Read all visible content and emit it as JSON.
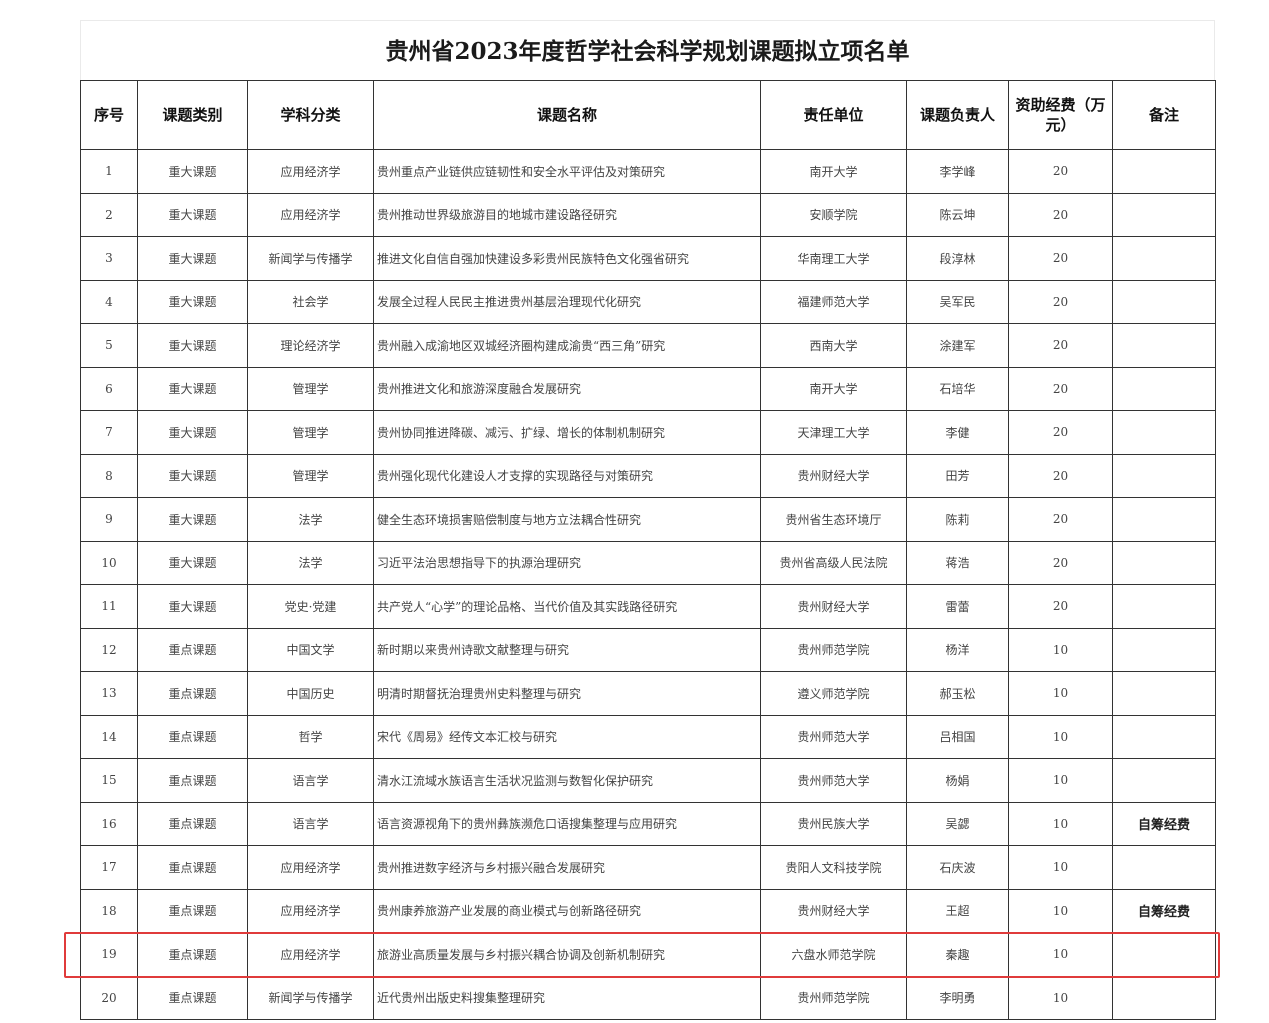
{
  "title": "贵州省2023年度哲学社会科学规划课题拟立项名单",
  "columns": [
    "序号",
    "课题类别",
    "学科分类",
    "课题名称",
    "责任单位",
    "课题负责人",
    "资助经费（万元）",
    "备注"
  ],
  "rows": [
    [
      "1",
      "重大课题",
      "应用经济学",
      "贵州重点产业链供应链韧性和安全水平评估及对策研究",
      "南开大学",
      "李学峰",
      "20",
      ""
    ],
    [
      "2",
      "重大课题",
      "应用经济学",
      "贵州推动世界级旅游目的地城市建设路径研究",
      "安顺学院",
      "陈云坤",
      "20",
      ""
    ],
    [
      "3",
      "重大课题",
      "新闻学与传播学",
      "推进文化自信自强加快建设多彩贵州民族特色文化强省研究",
      "华南理工大学",
      "段淳林",
      "20",
      ""
    ],
    [
      "4",
      "重大课题",
      "社会学",
      "发展全过程人民民主推进贵州基层治理现代化研究",
      "福建师范大学",
      "吴军民",
      "20",
      ""
    ],
    [
      "5",
      "重大课题",
      "理论经济学",
      "贵州融入成渝地区双城经济圈构建成渝贵“西三角”研究",
      "西南大学",
      "涂建军",
      "20",
      ""
    ],
    [
      "6",
      "重大课题",
      "管理学",
      "贵州推进文化和旅游深度融合发展研究",
      "南开大学",
      "石培华",
      "20",
      ""
    ],
    [
      "7",
      "重大课题",
      "管理学",
      "贵州协同推进降碳、减污、扩绿、增长的体制机制研究",
      "天津理工大学",
      "李健",
      "20",
      ""
    ],
    [
      "8",
      "重大课题",
      "管理学",
      "贵州强化现代化建设人才支撑的实现路径与对策研究",
      "贵州财经大学",
      "田芳",
      "20",
      ""
    ],
    [
      "9",
      "重大课题",
      "法学",
      "健全生态环境损害赔偿制度与地方立法耦合性研究",
      "贵州省生态环境厅",
      "陈莉",
      "20",
      ""
    ],
    [
      "10",
      "重大课题",
      "法学",
      "习近平法治思想指导下的执源治理研究",
      "贵州省高级人民法院",
      "蒋浩",
      "20",
      ""
    ],
    [
      "11",
      "重大课题",
      "党史·党建",
      "共产党人“心学”的理论品格、当代价值及其实践路径研究",
      "贵州财经大学",
      "雷蕾",
      "20",
      ""
    ],
    [
      "12",
      "重点课题",
      "中国文学",
      "新时期以来贵州诗歌文献整理与研究",
      "贵州师范学院",
      "杨洋",
      "10",
      ""
    ],
    [
      "13",
      "重点课题",
      "中国历史",
      "明清时期督抚治理贵州史料整理与研究",
      "遵义师范学院",
      "郝玉松",
      "10",
      ""
    ],
    [
      "14",
      "重点课题",
      "哲学",
      "宋代《周易》经传文本汇校与研究",
      "贵州师范大学",
      "吕相国",
      "10",
      ""
    ],
    [
      "15",
      "重点课题",
      "语言学",
      "清水江流域水族语言生活状况监测与数智化保护研究",
      "贵州师范大学",
      "杨娟",
      "10",
      ""
    ],
    [
      "16",
      "重点课题",
      "语言学",
      "语言资源视角下的贵州彝族濒危口语搜集整理与应用研究",
      "贵州民族大学",
      "吴勰",
      "10",
      "自筹经费"
    ],
    [
      "17",
      "重点课题",
      "应用经济学",
      "贵州推进数字经济与乡村振兴融合发展研究",
      "贵阳人文科技学院",
      "石庆波",
      "10",
      ""
    ],
    [
      "18",
      "重点课题",
      "应用经济学",
      "贵州康养旅游产业发展的商业模式与创新路径研究",
      "贵州财经大学",
      "王超",
      "10",
      "自筹经费"
    ],
    [
      "19",
      "重点课题",
      "应用经济学",
      "旅游业高质量发展与乡村振兴耦合协调及创新机制研究",
      "六盘水师范学院",
      "秦趣",
      "10",
      ""
    ],
    [
      "20",
      "重点课题",
      "新闻学与传播学",
      "近代贵州出版史料搜集整理研究",
      "贵州师范学院",
      "李明勇",
      "10",
      ""
    ]
  ]
}
